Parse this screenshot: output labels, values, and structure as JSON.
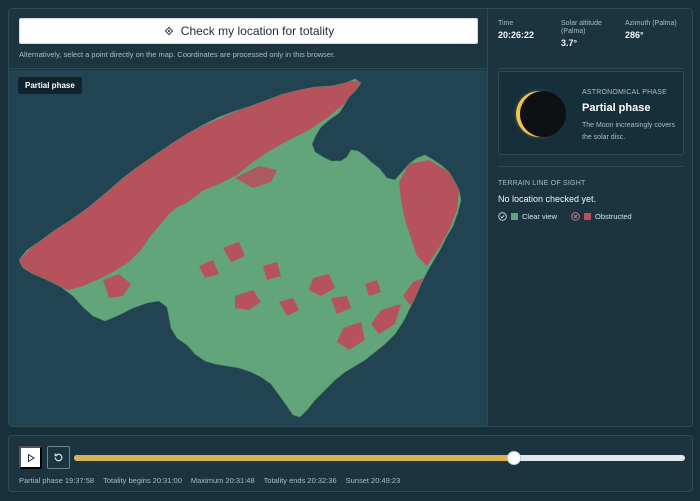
{
  "locate": {
    "button_label": "Check my location for totality",
    "hint": "Alternatively, select a point directly on the map. Coordinates are processed only in this browser."
  },
  "map": {
    "phase_chip": "Partial phase",
    "colors": {
      "water": "#224452",
      "clear": "#63a57a",
      "obstructed": "#b5525c"
    }
  },
  "stats": {
    "time": {
      "label": "Time",
      "value": "20:26:22"
    },
    "altitude": {
      "label": "Solar altitude (Palma)",
      "value": "3.7°"
    },
    "azimuth": {
      "label": "Azimuth (Palma)",
      "value": "286°"
    }
  },
  "phase_card": {
    "kicker": "ASTRONOMICAL PHASE",
    "title": "Partial phase",
    "description": "The Moon increasingly covers the solar disc."
  },
  "los": {
    "kicker": "TERRAIN LINE OF SIGHT",
    "status": "No location checked yet.",
    "legend_clear": "Clear view",
    "legend_obstructed": "Obstructed"
  },
  "timeline": {
    "progress": 0.72,
    "events": [
      "Partial phase 19:37:58",
      "Totality begins 20:31:00",
      "Maximum 20:31:48",
      "Totality ends 20:32:36",
      "Sunset 20:49:23"
    ]
  },
  "icons": [
    "crosshair-icon",
    "play-icon",
    "reset-icon",
    "check-circle-icon",
    "x-circle-icon"
  ]
}
